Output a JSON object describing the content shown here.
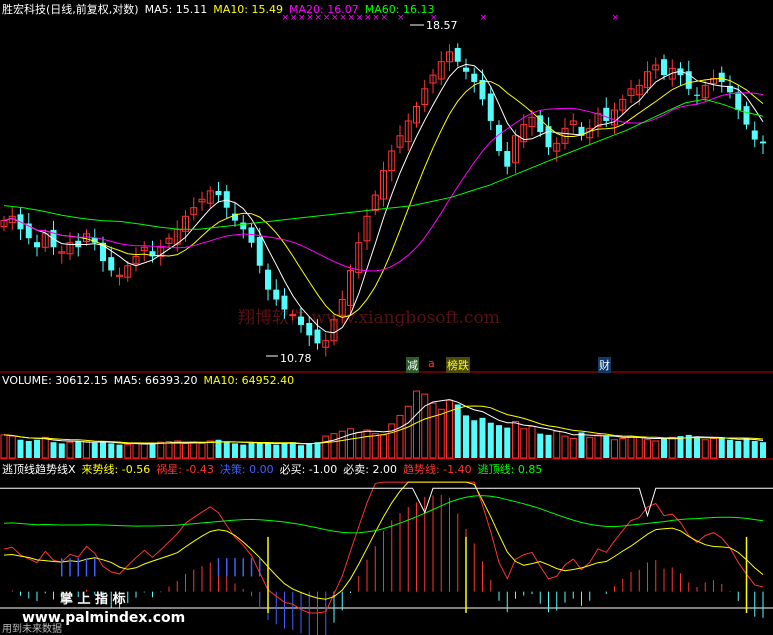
{
  "colors": {
    "background": "#000000",
    "up": "#ff3232",
    "down": "#54fcfc",
    "ma5": "#ffffff",
    "ma10": "#ffff00",
    "ma20": "#ff00ff",
    "ma60": "#00ff00",
    "divider": "#c00000",
    "watermark": "#5a1010"
  },
  "price_header": {
    "title": "胜宏科技(日线,前复权,对数)",
    "ma5": "MA5: 15.11",
    "ma10": "MA10: 15.49",
    "ma20": "MA20: 16.07",
    "ma60": "MA60: 16.13"
  },
  "volume_header": {
    "title": "VOLUME: 30612.15",
    "ma5": "MA5: 66393.20",
    "ma10": "MA10: 64952.40"
  },
  "indicator_header": {
    "title": "逃顶线趋势线X",
    "laishi": "来势线: -0.56",
    "huoxing": "祸星: -0.43",
    "juece": "决策: 0.00",
    "bimai": "必买: -1.00",
    "bimai2": "必卖: 2.00",
    "qushi": "趋势线: -1.40",
    "taoding": "逃顶线: 0.85"
  },
  "annotations": {
    "high_label": "18.57",
    "low_label": "10.78",
    "tag_jian": "减",
    "tag_small": "a",
    "tag_bangdie": "榜跌",
    "tag_cai": "财",
    "watermark": "翔博软件 www.xiangbosoft.com",
    "bottom_left": "掌 上 指 标",
    "site": "www.palmindex.com",
    "footer": "用到未来数据"
  },
  "chart_data": [
    {
      "type": "candlestick",
      "title": "胜宏科技(日线,前复权,对数)",
      "scale": "log",
      "ylim": [
        10.5,
        19.2
      ],
      "marked_high": 18.57,
      "marked_low": 10.78,
      "series_names": [
        "MA5",
        "MA10",
        "MA20",
        "MA60"
      ],
      "close": [
        13.5,
        13.6,
        13.3,
        13.1,
        12.9,
        13.2,
        12.9,
        12.8,
        13.0,
        12.9,
        13.2,
        13.0,
        12.6,
        12.4,
        12.3,
        12.5,
        12.7,
        12.9,
        12.7,
        12.9,
        13.1,
        13.3,
        13.6,
        13.8,
        14.0,
        14.2,
        14.1,
        13.8,
        13.5,
        13.3,
        13.0,
        12.5,
        12.0,
        11.8,
        11.6,
        11.5,
        11.3,
        11.1,
        10.95,
        11.0,
        11.4,
        11.8,
        12.4,
        13.0,
        13.6,
        14.1,
        14.7,
        15.2,
        15.6,
        16.0,
        16.4,
        16.9,
        17.3,
        17.7,
        18.0,
        17.7,
        17.4,
        17.1,
        16.6,
        16.0,
        15.2,
        14.8,
        15.6,
        15.9,
        16.1,
        15.7,
        15.3,
        15.4,
        15.8,
        16.0,
        15.6,
        15.8,
        16.2,
        16.0,
        16.3,
        16.6,
        16.9,
        17.0,
        17.4,
        17.6,
        17.3,
        17.5,
        17.3,
        16.9,
        16.7,
        17.0,
        17.2,
        17.1,
        16.8,
        16.3,
        15.9,
        15.5,
        15.4
      ],
      "ma60_key": [
        13.85,
        13.8,
        13.72,
        13.62,
        13.55,
        13.5,
        13.48,
        13.42,
        13.35,
        13.3,
        13.3,
        13.35,
        13.4,
        13.45,
        13.5,
        13.55,
        13.6,
        13.65,
        13.7,
        13.75,
        13.8,
        13.85,
        13.95,
        14.05,
        14.2,
        14.35,
        14.55,
        14.75,
        14.95,
        15.15,
        15.35,
        15.55,
        15.75,
        16.0,
        16.25,
        16.5,
        16.6,
        16.45,
        16.25,
        16.13
      ]
    },
    {
      "type": "bar",
      "title": "VOLUME: 30612.15",
      "series_names": [
        "MA5",
        "MA10"
      ],
      "values": [
        38,
        36,
        30,
        28,
        30,
        34,
        26,
        24,
        26,
        28,
        27,
        25,
        26,
        24,
        22,
        22,
        24,
        23,
        25,
        26,
        27,
        28,
        24,
        26,
        24,
        28,
        30,
        26,
        24,
        22,
        26,
        25,
        24,
        22,
        24,
        26,
        21,
        24,
        26,
        36,
        40,
        44,
        48,
        42,
        46,
        40,
        38,
        56,
        70,
        85,
        110,
        105,
        90,
        80,
        95,
        88,
        70,
        62,
        66,
        58,
        54,
        50,
        60,
        48,
        52,
        40,
        38,
        44,
        36,
        32,
        42,
        34,
        38,
        36,
        30,
        32,
        36,
        34,
        30,
        28,
        32,
        34,
        36,
        38,
        34,
        30,
        32,
        34,
        30,
        28,
        32,
        28,
        26
      ]
    },
    {
      "type": "line",
      "title": "逃顶线趋势线X",
      "series_names": [
        "来势线",
        "祸星",
        "决策",
        "必买",
        "必卖",
        "趋势线",
        "逃顶线"
      ],
      "ylim": [
        -2.2,
        2.4
      ]
    }
  ]
}
